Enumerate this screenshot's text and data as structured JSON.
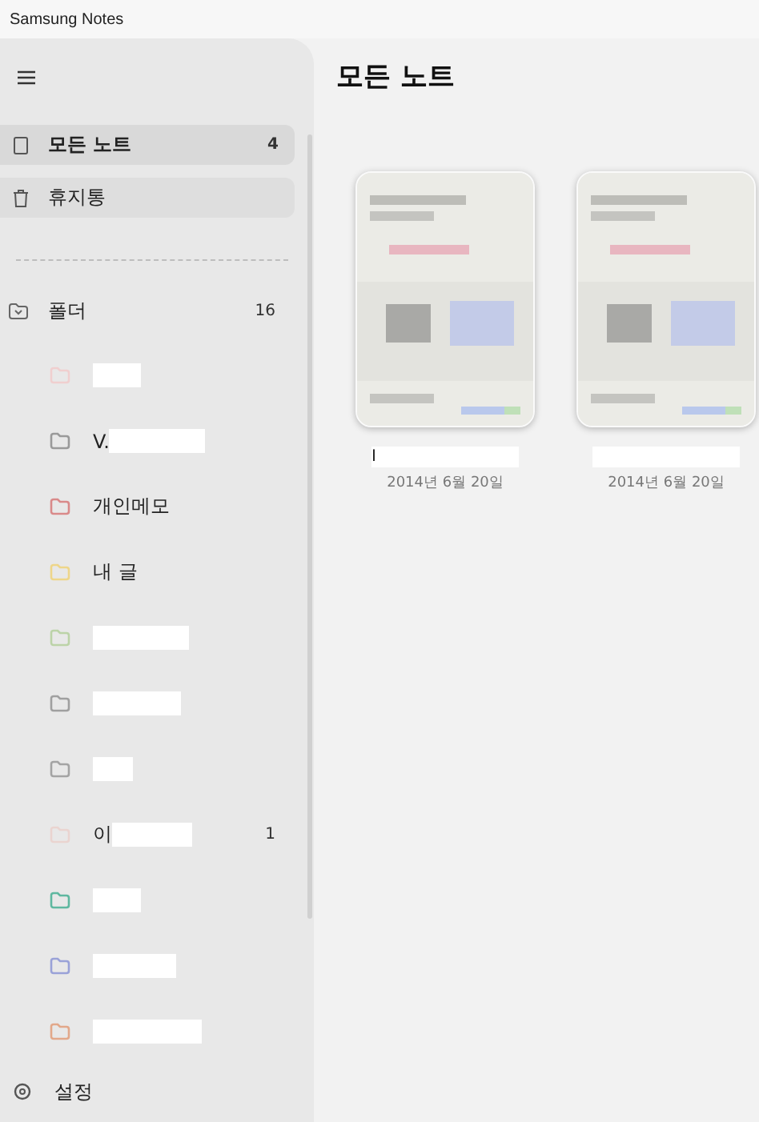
{
  "window": {
    "title": "Samsung Notes"
  },
  "sidebar": {
    "nav": [
      {
        "kind": "notes",
        "label": "모든 노트",
        "count": "4",
        "selected": true
      },
      {
        "kind": "trash",
        "label": "휴지통",
        "selected": false
      }
    ],
    "folders_header": {
      "label": "폴더",
      "count": "16",
      "expanded": true
    },
    "folders": [
      {
        "color": "#f0cfcf",
        "redacted": true
      },
      {
        "color": "#9a9a9a",
        "name": "V.",
        "redacted": true
      },
      {
        "color": "#d98a8a",
        "name": "개인메모",
        "redacted": false
      },
      {
        "color": "#eed68a",
        "name": "내 글",
        "redacted": false
      },
      {
        "color": "#bcd3a8",
        "redacted": true
      },
      {
        "color": "#a0a0a0",
        "redacted": true
      },
      {
        "color": "#a4a4a4",
        "redacted": true
      },
      {
        "color": "#ead4d0",
        "name": "이",
        "count": "1",
        "redacted": true
      },
      {
        "color": "#5fb8a0",
        "redacted": true
      },
      {
        "color": "#9aa2d8",
        "redacted": true
      },
      {
        "color": "#e2a88a",
        "redacted": true
      }
    ],
    "settings": {
      "label": "설정"
    }
  },
  "main": {
    "title": "모든 노트",
    "notes": [
      {
        "title": "I",
        "date": "2014년 6월 20일",
        "kind": "picture"
      },
      {
        "date": "2014년 6월 20일",
        "kind": "picture"
      }
    ]
  }
}
